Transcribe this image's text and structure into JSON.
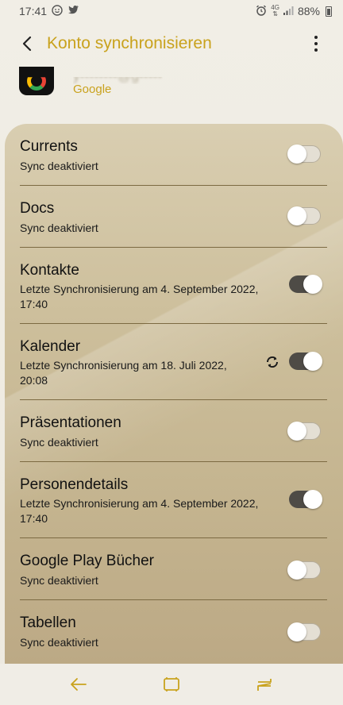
{
  "status_bar": {
    "time": "17:41",
    "network": "4G",
    "battery": "88%"
  },
  "header": {
    "title": "Konto synchronisieren"
  },
  "account": {
    "email": "y••••••••@g•••••",
    "provider": "Google"
  },
  "sync_items": [
    {
      "title": "Currents",
      "status": "Sync deaktiviert",
      "enabled": false
    },
    {
      "title": "Docs",
      "status": "Sync deaktiviert",
      "enabled": false
    },
    {
      "title": "Kontakte",
      "status": "Letzte Synchronisierung am 4. September 2022,\n17:40",
      "enabled": true
    },
    {
      "title": "Kalender",
      "status": "Letzte Synchronisierung am 18. Juli 2022,\n20:08",
      "enabled": true,
      "syncing_icon": "sync-icon"
    },
    {
      "title": "Präsentationen",
      "status": "Sync deaktiviert",
      "enabled": false
    },
    {
      "title": "Personendetails",
      "status": "Letzte Synchronisierung am 4. September 2022,\n17:40",
      "enabled": true
    },
    {
      "title": "Google Play Bücher",
      "status": "Sync deaktiviert",
      "enabled": false
    },
    {
      "title": "Tabellen",
      "status": "Sync deaktiviert",
      "enabled": false
    }
  ],
  "colors": {
    "accent": "#c9a21d",
    "toggle_on": "#4e4b46"
  }
}
